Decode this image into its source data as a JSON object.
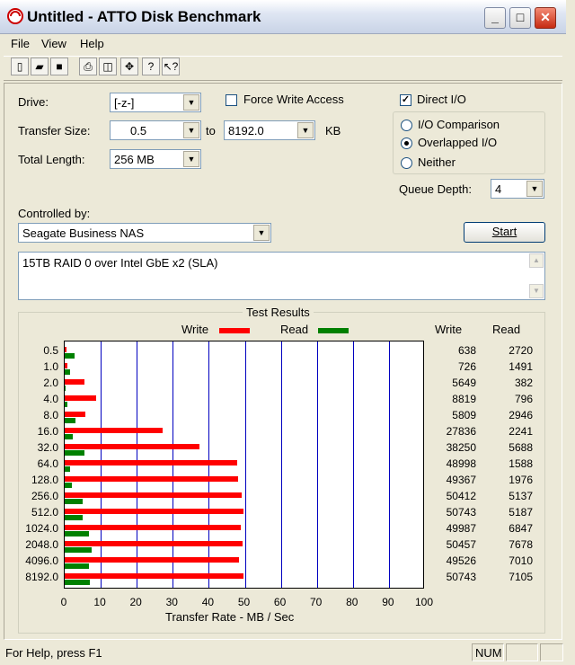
{
  "window": {
    "title": "Untitled - ATTO Disk Benchmark"
  },
  "menu": [
    {
      "label": "File"
    },
    {
      "label": "View"
    },
    {
      "label": "Help"
    }
  ],
  "controls": {
    "drive_label": "Drive:",
    "drive_value": "[-z-]",
    "force_write_label": "Force Write Access",
    "force_write_checked": false,
    "direct_io_label": "Direct I/O",
    "direct_io_checked": true,
    "transfer_size_label": "Transfer Size:",
    "transfer_size_from": "0.5",
    "to_label": "to",
    "transfer_size_to": "8192.0",
    "kb_label": "KB",
    "total_length_label": "Total Length:",
    "total_length_value": "256 MB",
    "io_comparison_label": "I/O Comparison",
    "overlapped_io_label": "Overlapped I/O",
    "neither_label": "Neither",
    "selected_mode": "Overlapped I/O",
    "queue_depth_label": "Queue Depth:",
    "queue_depth_value": "4",
    "controlled_by_label": "Controlled by:",
    "controlled_by_value": "Seagate Business NAS",
    "start_label": "Start",
    "description": "15TB RAID 0 over Intel GbE x2 (SLA)"
  },
  "results": {
    "title": "Test Results",
    "write_legend": "Write",
    "read_legend": "Read",
    "write_col": "Write",
    "read_col": "Read",
    "xlabel": "Transfer Rate - MB / Sec"
  },
  "chart_data": {
    "type": "bar",
    "orientation": "horizontal",
    "title": "Test Results",
    "xlabel": "Transfer Rate - MB / Sec",
    "xlim": [
      0,
      100
    ],
    "xticks": [
      0,
      10,
      20,
      30,
      40,
      50,
      60,
      70,
      80,
      90,
      100
    ],
    "grid": true,
    "legend_position": "top",
    "colors": {
      "write": "#ff0000",
      "read": "#008000"
    },
    "categories": [
      "0.5",
      "1.0",
      "2.0",
      "4.0",
      "8.0",
      "16.0",
      "32.0",
      "64.0",
      "128.0",
      "256.0",
      "512.0",
      "1024.0",
      "2048.0",
      "4096.0",
      "8192.0"
    ],
    "series": [
      {
        "name": "Write",
        "values": [
          638,
          726,
          5649,
          8819,
          5809,
          27836,
          38250,
          48998,
          49367,
          50412,
          50743,
          49987,
          50457,
          49526,
          50743
        ],
        "unit": "KB/s"
      },
      {
        "name": "Read",
        "values": [
          2720,
          1491,
          382,
          796,
          2946,
          2241,
          5688,
          1588,
          1976,
          5137,
          5187,
          6847,
          7678,
          7010,
          7105
        ],
        "unit": "KB/s"
      }
    ]
  },
  "status": {
    "help_text": "For Help, press F1",
    "num_indicator": "NUM"
  }
}
